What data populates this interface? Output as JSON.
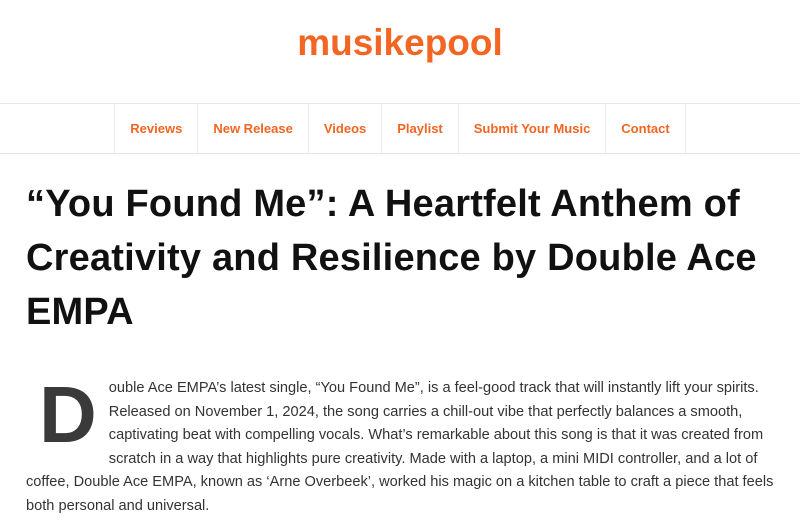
{
  "site": {
    "logo": "musikepool"
  },
  "nav": {
    "items": [
      {
        "label": "Reviews"
      },
      {
        "label": "New Release"
      },
      {
        "label": "Videos"
      },
      {
        "label": "Playlist"
      },
      {
        "label": "Submit Your Music"
      },
      {
        "label": "Contact"
      }
    ]
  },
  "article": {
    "title": "“You Found Me”: A Heartfelt Anthem of Creativity and Resilience by Double Ace EMPA",
    "drop_cap": "D",
    "first_paragraph": "ouble Ace EMPA’s latest single, “You Found Me”, is a feel-good track that will instantly lift your spirits. Released on November 1, 2024, the song carries a chill-out vibe that perfectly balances a smooth, captivating beat with compelling vocals. What’s remarkable about this song is that it was created from scratch in a way that highlights pure creativity. Made with a laptop, a mini MIDI controller, and a lot of coffee, Double Ace EMPA, known as ‘Arne Overbeek’, worked his magic on a kitchen table to craft a piece that feels both personal and universal."
  },
  "colors": {
    "accent": "#f26522",
    "title": "#111111",
    "body": "#333333"
  }
}
